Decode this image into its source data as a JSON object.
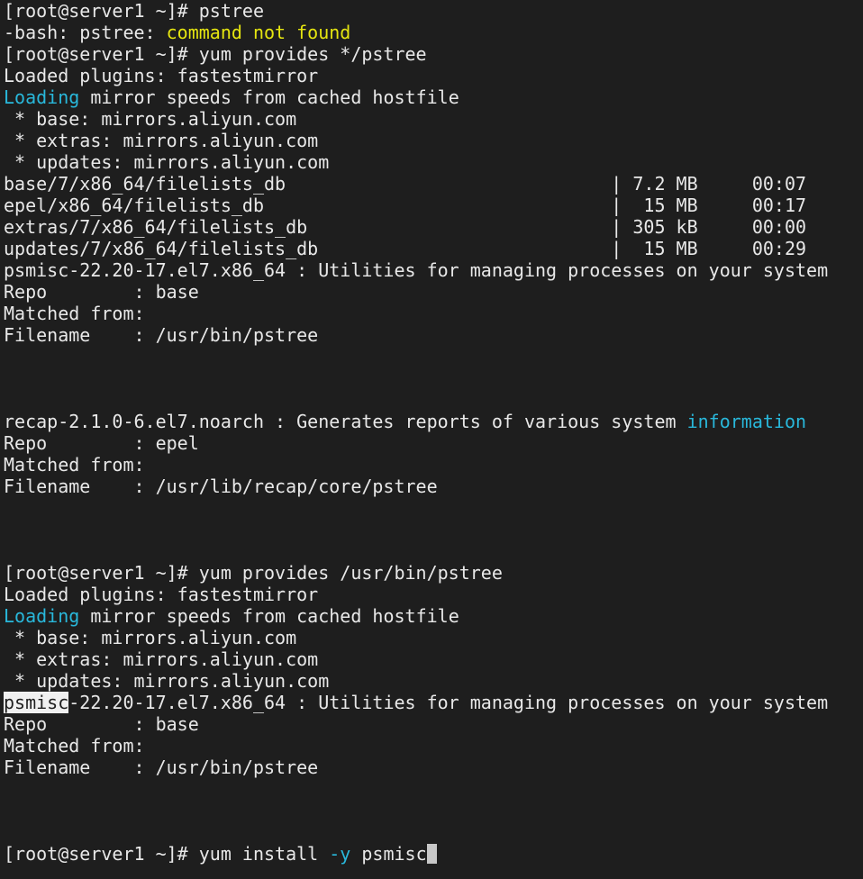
{
  "terminal": {
    "lines": [
      {
        "t": "[root@server1 ~]# pstree"
      },
      {
        "t": "-bash: pstree: ",
        "hl": "command not found"
      },
      {
        "t": "[root@server1 ~]# yum provides */pstree"
      },
      {
        "t": "Loaded plugins: fastestmirror"
      },
      {
        "hl_cyan": "Loading",
        "t": " mirror speeds from cached hostfile"
      },
      {
        "t": " * base: mirrors.aliyun.com"
      },
      {
        "t": " * extras: mirrors.aliyun.com"
      },
      {
        "t": " * updates: mirrors.aliyun.com"
      },
      {
        "t": "base/7/x86_64/filelists_db                              | 7.2 MB     00:07"
      },
      {
        "t": "epel/x86_64/filelists_db                                |  15 MB     00:17"
      },
      {
        "t": "extras/7/x86_64/filelists_db                            | 305 kB     00:00"
      },
      {
        "t": "updates/7/x86_64/filelists_db                           |  15 MB     00:29"
      },
      {
        "t": "psmisc-22.20-17.el7.x86_64 : Utilities for managing processes on your system"
      },
      {
        "t": "Repo        : base"
      },
      {
        "t": "Matched from:"
      },
      {
        "t": "Filename    : /usr/bin/pstree"
      },
      {
        "t": ""
      },
      {
        "t": ""
      },
      {
        "t": ""
      },
      {
        "t": "recap-2.1.0-6.el7.noarch : Generates reports of various system ",
        "tail_cyan": "information"
      },
      {
        "t": "Repo        : epel"
      },
      {
        "t": "Matched from:"
      },
      {
        "t": "Filename    : /usr/lib/recap/core/pstree"
      },
      {
        "t": ""
      },
      {
        "t": ""
      },
      {
        "t": ""
      },
      {
        "t": "[root@server1 ~]# yum provides /usr/bin/pstree"
      },
      {
        "t": "Loaded plugins: fastestmirror"
      },
      {
        "hl_cyan": "Loading",
        "t": " mirror speeds from cached hostfile"
      },
      {
        "t": " * base: mirrors.aliyun.com"
      },
      {
        "t": " * extras: mirrors.aliyun.com"
      },
      {
        "t": " * updates: mirrors.aliyun.com"
      },
      {
        "sel": "psmisc",
        "t": "-22.20-17.el7.x86_64 : Utilities for managing processes on your system"
      },
      {
        "t": "Repo        : base"
      },
      {
        "t": "Matched from:"
      },
      {
        "t": "Filename    : /usr/bin/pstree"
      },
      {
        "t": ""
      },
      {
        "t": ""
      },
      {
        "t": ""
      }
    ],
    "prompt": {
      "pre": "[root@server1 ~]# yum install ",
      "flag": "-y",
      "post": " psmisc"
    }
  }
}
